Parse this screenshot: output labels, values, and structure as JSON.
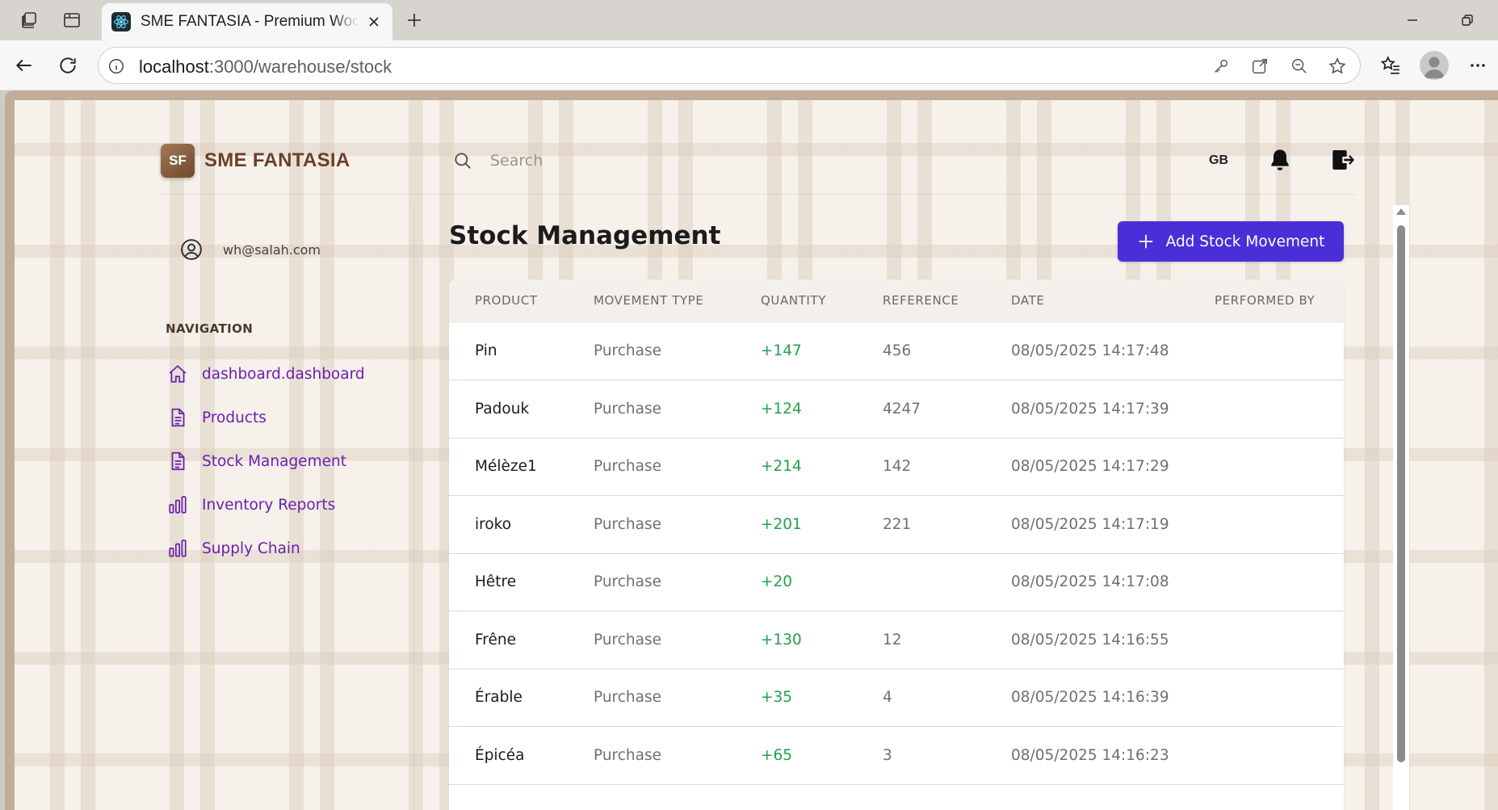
{
  "browser": {
    "tab_title": "SME FANTASIA - Premium Wood Products",
    "url_host": "localhost",
    "url_path": ":3000/warehouse/stock"
  },
  "brand": {
    "logo_text": "SF",
    "name": "SME FANTASIA"
  },
  "search": {
    "placeholder": "Search"
  },
  "header": {
    "language": "GB"
  },
  "user": {
    "email": "wh@salah.com"
  },
  "sidebar": {
    "heading": "NAVIGATION",
    "items": [
      {
        "label": "dashboard.dashboard",
        "icon": "home-icon"
      },
      {
        "label": "Products",
        "icon": "document-icon"
      },
      {
        "label": "Stock Management",
        "icon": "document-icon"
      },
      {
        "label": "Inventory Reports",
        "icon": "bar-chart-icon"
      },
      {
        "label": "Supply Chain",
        "icon": "bar-chart-icon"
      }
    ]
  },
  "main": {
    "title": "Stock Management",
    "add_button_label": "Add Stock Movement"
  },
  "table": {
    "columns": [
      "PRODUCT",
      "MOVEMENT TYPE",
      "QUANTITY",
      "REFERENCE",
      "DATE",
      "PERFORMED BY"
    ],
    "rows": [
      {
        "product": "Pin",
        "type": "Purchase",
        "quantity": "+147",
        "reference": "456",
        "date": "08/05/2025 14:17:48",
        "performed_by": ""
      },
      {
        "product": "Padouk",
        "type": "Purchase",
        "quantity": "+124",
        "reference": "4247",
        "date": "08/05/2025 14:17:39",
        "performed_by": ""
      },
      {
        "product": "Mélèze1",
        "type": "Purchase",
        "quantity": "+214",
        "reference": "142",
        "date": "08/05/2025 14:17:29",
        "performed_by": ""
      },
      {
        "product": "iroko",
        "type": "Purchase",
        "quantity": "+201",
        "reference": "221",
        "date": "08/05/2025 14:17:19",
        "performed_by": ""
      },
      {
        "product": "Hêtre",
        "type": "Purchase",
        "quantity": "+20",
        "reference": "",
        "date": "08/05/2025 14:17:08",
        "performed_by": ""
      },
      {
        "product": "Frêne",
        "type": "Purchase",
        "quantity": "+130",
        "reference": "12",
        "date": "08/05/2025 14:16:55",
        "performed_by": ""
      },
      {
        "product": "Érable",
        "type": "Purchase",
        "quantity": "+35",
        "reference": "4",
        "date": "08/05/2025 14:16:39",
        "performed_by": ""
      },
      {
        "product": "Épicéa",
        "type": "Purchase",
        "quantity": "+65",
        "reference": "3",
        "date": "08/05/2025 14:16:23",
        "performed_by": ""
      }
    ]
  },
  "colors": {
    "accent_button": "#4a2fd8",
    "nav_link": "#6a1fb1",
    "quantity_positive": "#22a04b",
    "brand_text": "#6b3f26"
  }
}
